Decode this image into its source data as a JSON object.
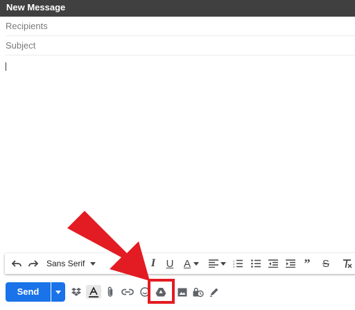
{
  "compose": {
    "title": "New Message",
    "recipients_placeholder": "Recipients",
    "subject_placeholder": "Subject",
    "body_value": ""
  },
  "format_toolbar": {
    "font_family": "Sans Serif",
    "buttons": [
      "undo-icon",
      "redo-icon",
      "font-select",
      "font-size-icon",
      "bold-icon",
      "italic-icon",
      "underline-icon",
      "text-color-icon",
      "align-icon",
      "numbered-list-icon",
      "bulleted-list-icon",
      "indent-less-icon",
      "indent-more-icon",
      "quote-icon",
      "strikethrough-icon",
      "remove-formatting-icon"
    ]
  },
  "bottom_toolbar": {
    "send_label": "Send",
    "icons": [
      "dropbox-icon",
      "formatting-options-icon",
      "attach-file-icon",
      "insert-link-icon",
      "insert-emoji-icon",
      "google-drive-icon",
      "insert-photo-icon",
      "confidential-mode-icon",
      "signature-icon"
    ]
  },
  "annotation": {
    "highlight_color": "#e31b23",
    "points_to": "google-drive-icon"
  },
  "colors": {
    "titlebar": "#404040",
    "send": "#1a73e8"
  }
}
